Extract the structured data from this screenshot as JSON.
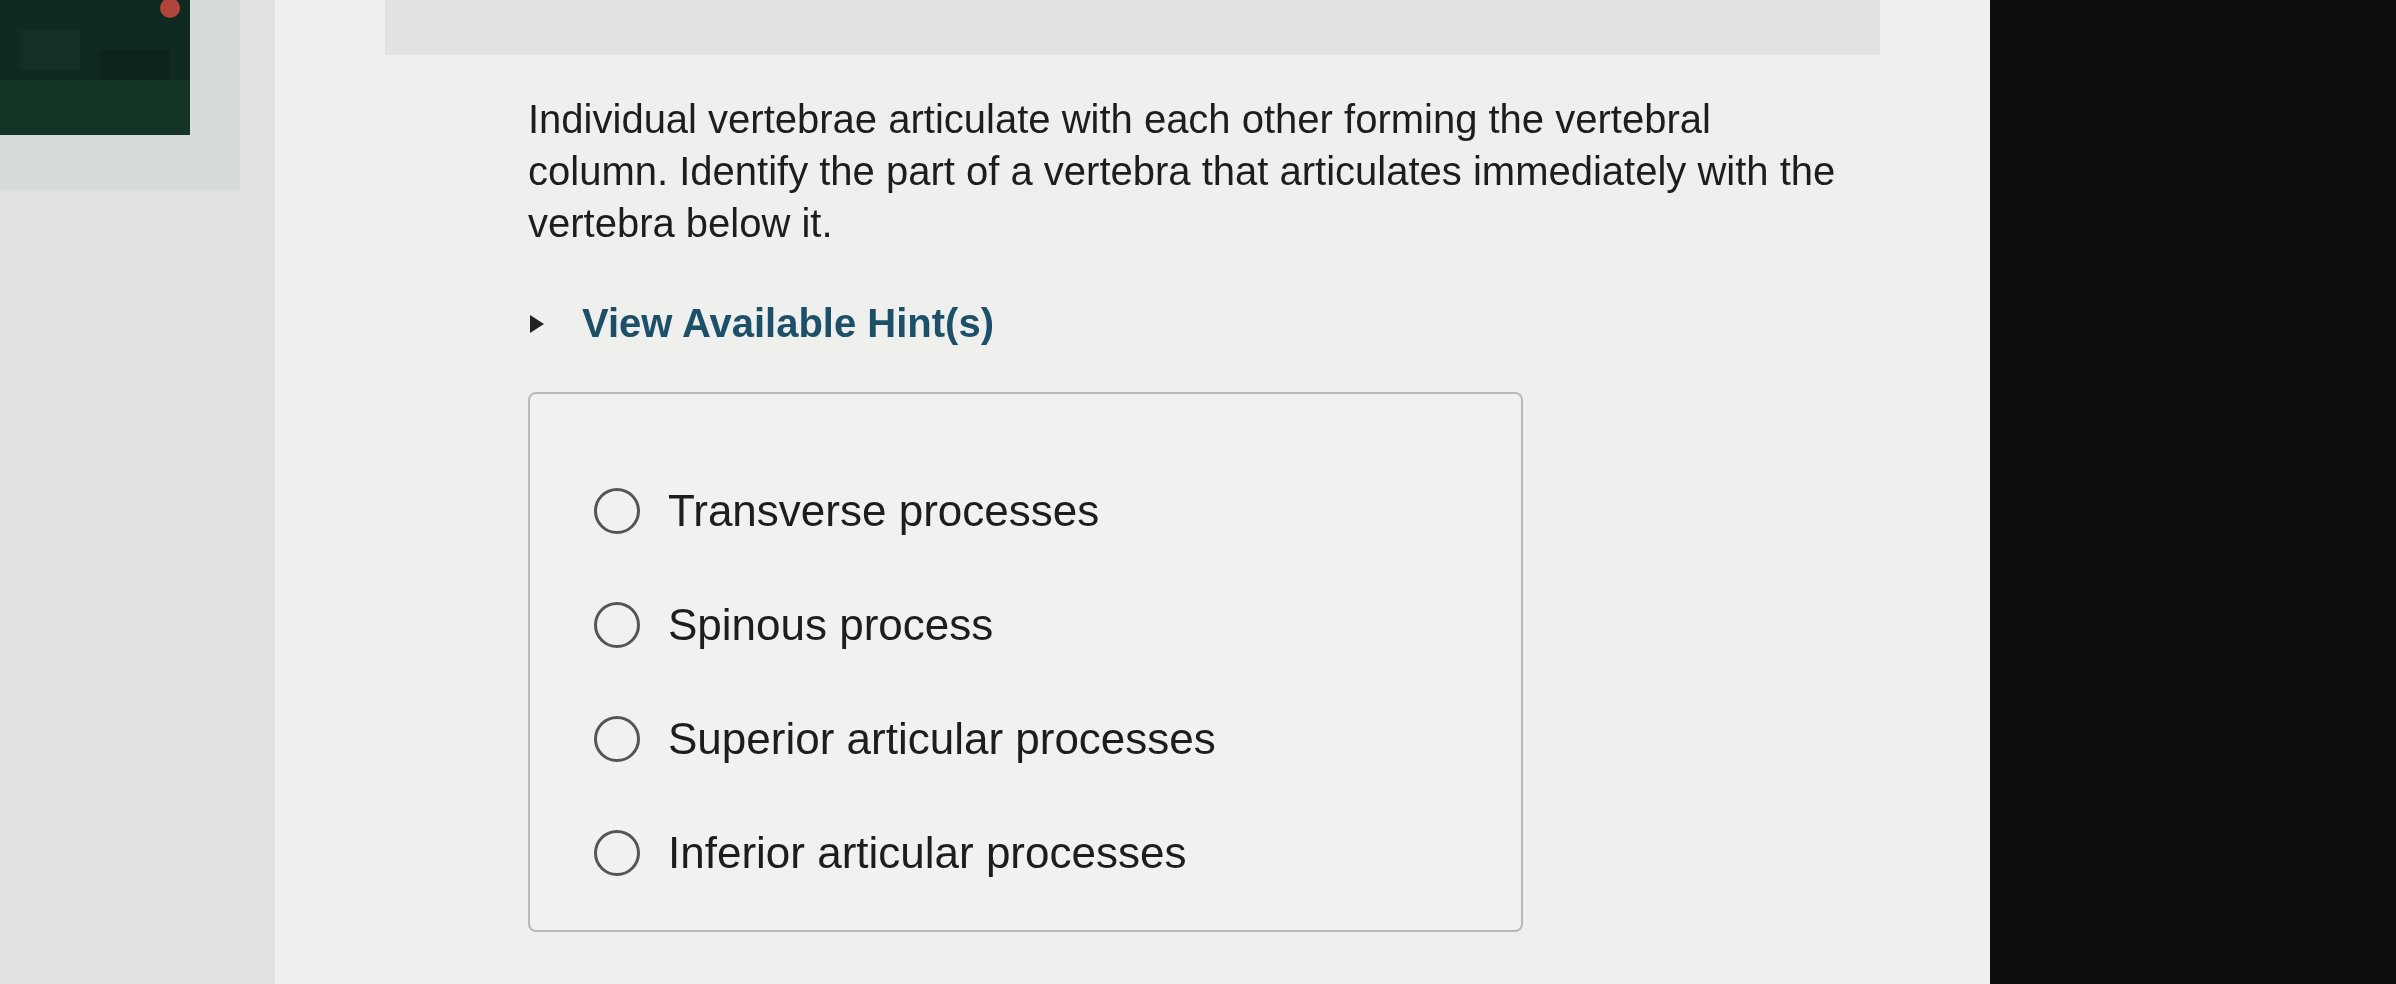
{
  "question": "Individual vertebrae articulate with each other forming the vertebral column. Identify the part of a vertebra that articulates immediately with the vertebra below it.",
  "hint": {
    "label": "View Available Hint(s)",
    "expanded": false
  },
  "options": [
    {
      "label": "Transverse processes",
      "selected": false
    },
    {
      "label": "Spinous process",
      "selected": false
    },
    {
      "label": "Superior articular processes",
      "selected": false
    },
    {
      "label": "Inferior articular processes",
      "selected": false
    }
  ]
}
